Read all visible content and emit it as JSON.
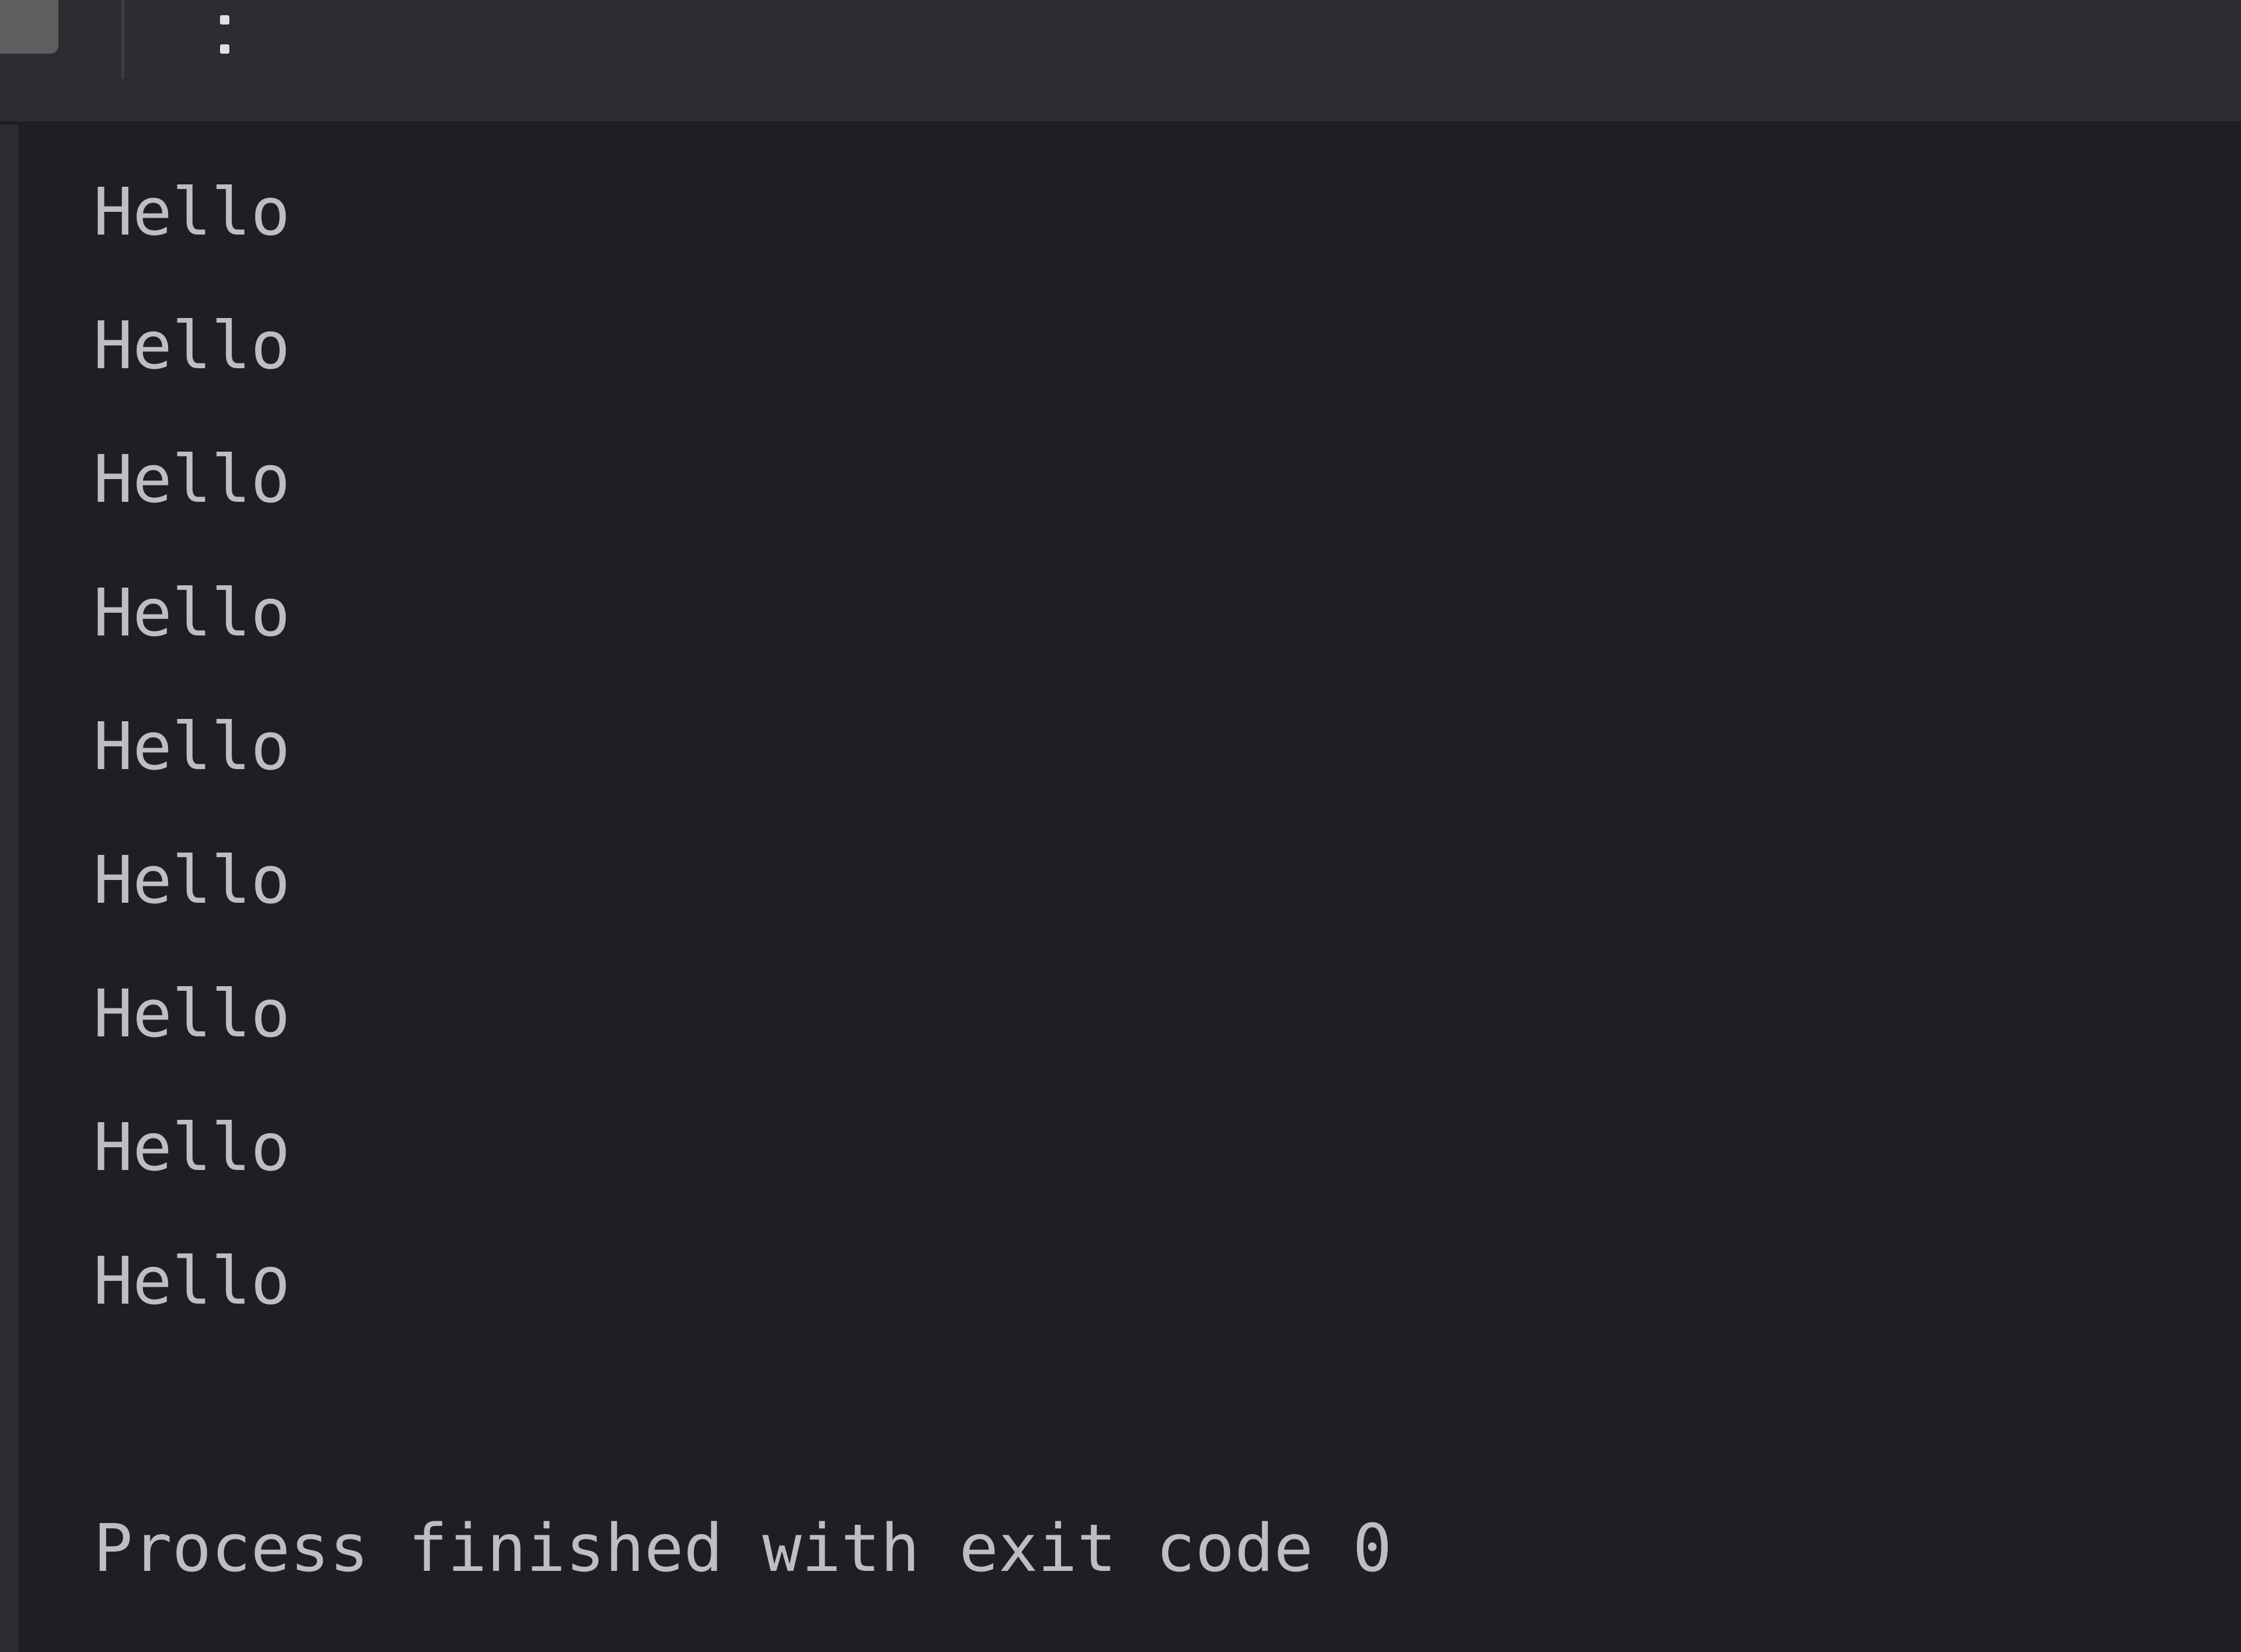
{
  "toolbar": {
    "stop_icon": "stop-square-icon",
    "more_icon": "more-vertical-icon"
  },
  "console": {
    "lines": [
      "Hello",
      "Hello",
      "Hello",
      "Hello",
      "Hello",
      "Hello",
      "Hello",
      "Hello",
      "Hello"
    ],
    "blank": "",
    "exit_message": "Process finished with exit code 0"
  },
  "colors": {
    "background": "#1e1f22",
    "toolbar": "#2b2d30",
    "text": "#bcbec4"
  }
}
